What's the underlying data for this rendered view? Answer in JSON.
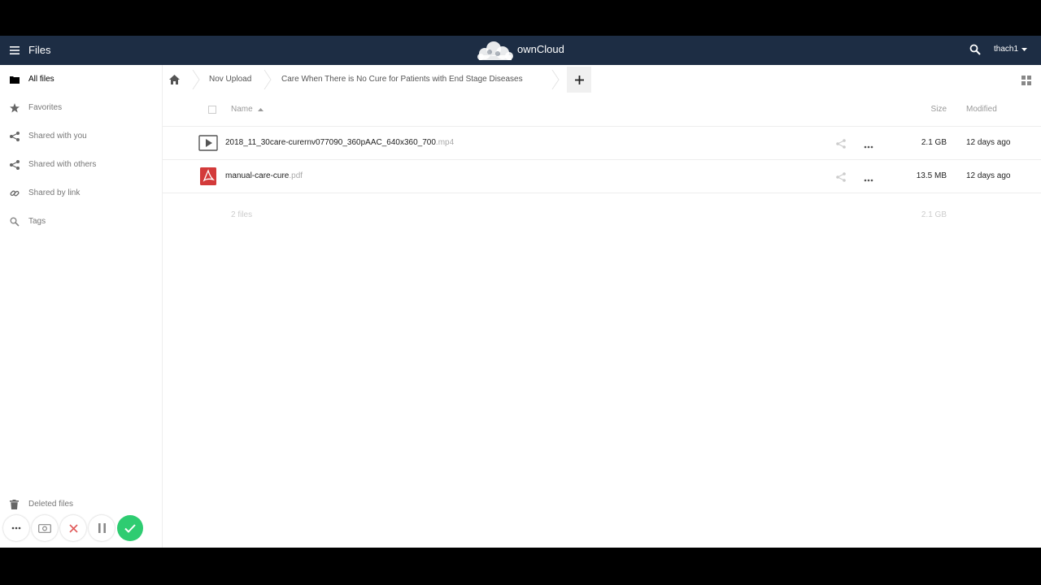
{
  "header": {
    "app_title": "Files",
    "brand": "ownCloud",
    "username": "thach1",
    "brand_color": "#1d2d44"
  },
  "sidebar": {
    "items": [
      {
        "label": "All files",
        "icon": "folder-icon",
        "active": true
      },
      {
        "label": "Favorites",
        "icon": "star-icon"
      },
      {
        "label": "Shared with you",
        "icon": "share-icon"
      },
      {
        "label": "Shared with others",
        "icon": "share-icon"
      },
      {
        "label": "Shared by link",
        "icon": "link-icon"
      },
      {
        "label": "Tags",
        "icon": "tag-icon"
      }
    ],
    "deleted_files": "Deleted files"
  },
  "breadcrumb": {
    "items": [
      "Nov Upload",
      "Care When There is No Cure for Patients with End Stage Diseases"
    ]
  },
  "table": {
    "columns": {
      "name": "Name",
      "size": "Size",
      "modified": "Modified"
    },
    "rows": [
      {
        "base": "2018_11_30care-curernv077090_360pAAC_640x360_700",
        "ext": ".mp4",
        "size": "2.1 GB",
        "modified": "12 days ago",
        "icon": "video-file-icon"
      },
      {
        "base": "manual-care-cure",
        "ext": ".pdf",
        "size": "13.5 MB",
        "modified": "12 days ago",
        "icon": "pdf-file-icon"
      }
    ],
    "summary": {
      "count": "2 files",
      "size": "2.1 GB"
    }
  }
}
